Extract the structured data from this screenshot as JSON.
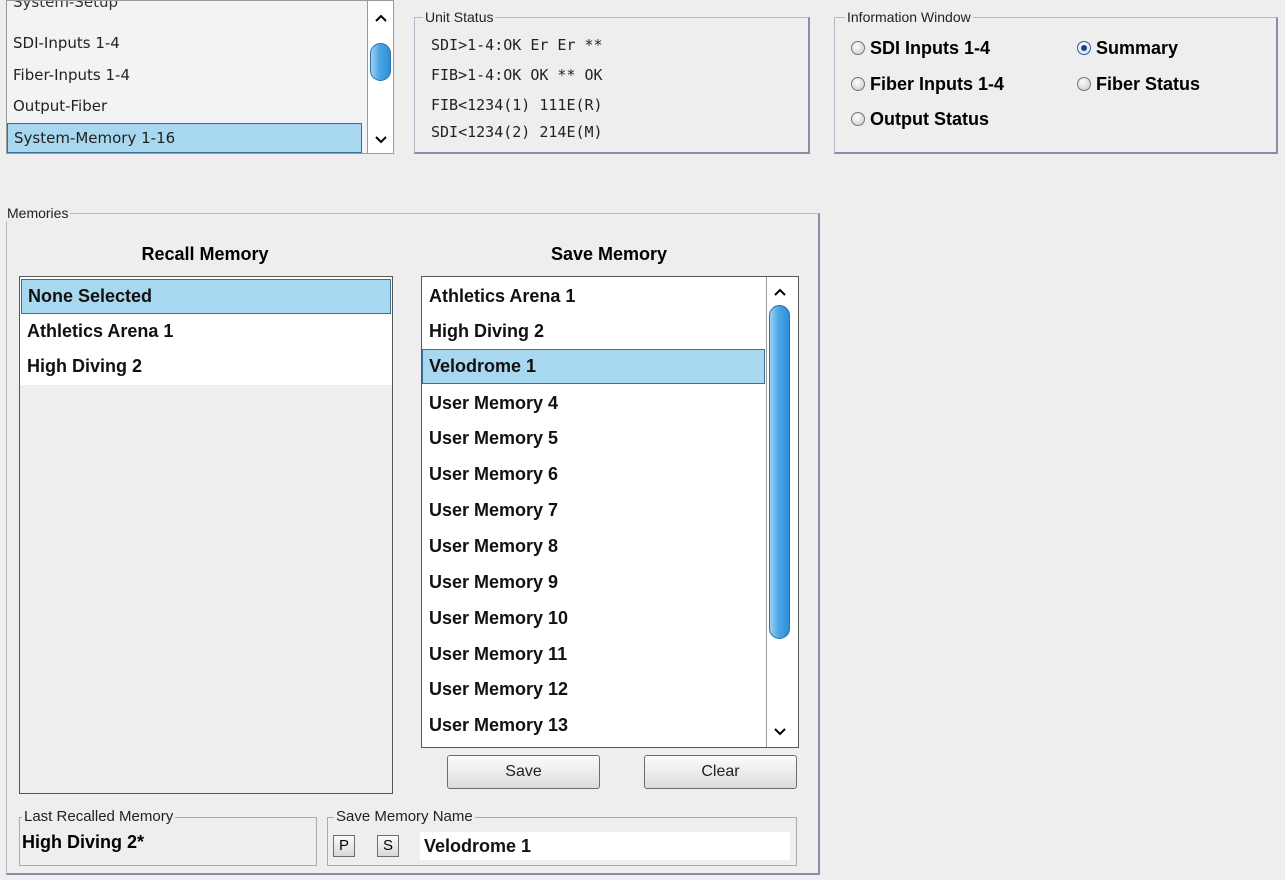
{
  "nav": {
    "items": [
      {
        "label": "System-Setup",
        "state": "partially-visible"
      },
      {
        "label": "SDI-Inputs 1-4"
      },
      {
        "label": "Fiber-Inputs 1-4"
      },
      {
        "label": "Output-Fiber"
      },
      {
        "label": "System-Memory 1-16",
        "selected": true
      }
    ]
  },
  "unit_status": {
    "title": "Unit Status",
    "lines": [
      "SDI>1-4:OK Er Er **",
      "FIB>1-4:OK OK ** OK",
      "FIB<1234(1) 111E(R)",
      "SDI<1234(2) 214E(M)"
    ]
  },
  "info_window": {
    "title": "Information Window",
    "options": [
      {
        "label": "SDI Inputs 1-4",
        "checked": false
      },
      {
        "label": "Summary",
        "checked": true
      },
      {
        "label": "Fiber Inputs 1-4",
        "checked": false
      },
      {
        "label": "Fiber Status",
        "checked": false
      },
      {
        "label": "Output Status",
        "checked": false
      }
    ]
  },
  "memories": {
    "title": "Memories",
    "recall": {
      "heading": "Recall Memory",
      "items": [
        {
          "label": "None Selected",
          "selected": true
        },
        {
          "label": "Athletics Arena 1"
        },
        {
          "label": "High Diving 2"
        }
      ]
    },
    "save": {
      "heading": "Save Memory",
      "items": [
        {
          "label": "Athletics Arena 1"
        },
        {
          "label": "High Diving 2"
        },
        {
          "label": "Velodrome 1",
          "selected": true
        },
        {
          "label": "User Memory 4"
        },
        {
          "label": "User Memory 5"
        },
        {
          "label": "User Memory 6"
        },
        {
          "label": "User Memory 7"
        },
        {
          "label": "User Memory 8"
        },
        {
          "label": "User Memory 9"
        },
        {
          "label": "User Memory 10"
        },
        {
          "label": "User Memory 11"
        },
        {
          "label": "User Memory 12"
        },
        {
          "label": "User Memory 13"
        }
      ],
      "save_label": "Save",
      "clear_label": "Clear"
    },
    "last_recalled": {
      "title": "Last Recalled Memory",
      "value": "High Diving 2*"
    },
    "save_name": {
      "title": "Save Memory Name",
      "p_label": "P",
      "s_label": "S",
      "value": "Velodrome 1"
    }
  },
  "colors": {
    "background": "#eeeeee",
    "selection": "#a8d8ef",
    "scroll_thumb": "#4aa6e6",
    "radio_selected": "#1d3f86"
  }
}
